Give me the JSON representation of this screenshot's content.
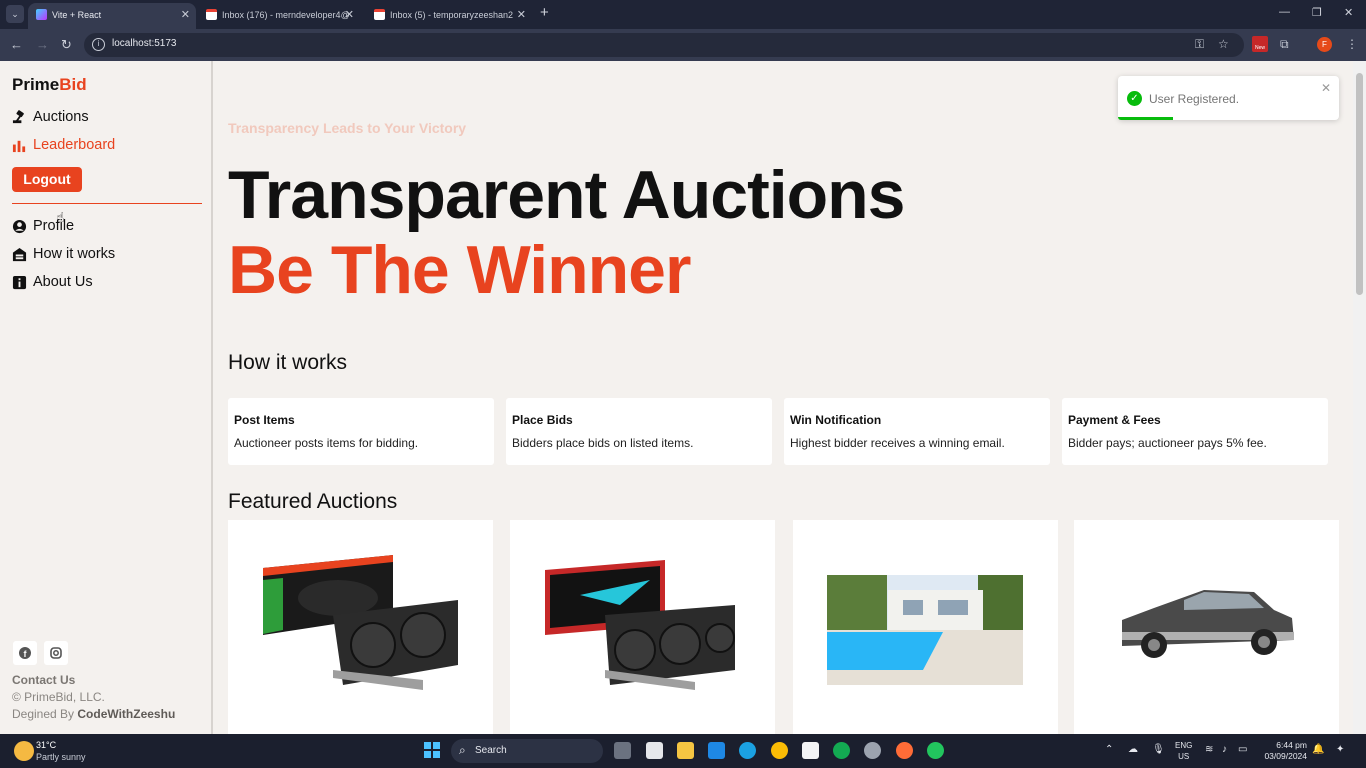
{
  "browser": {
    "tabs": [
      {
        "title": "Vite + React",
        "active": true
      },
      {
        "title": "Inbox (176) - merndeveloper4@",
        "active": false
      },
      {
        "title": "Inbox (5) - temporaryzeeshan2",
        "active": false
      }
    ],
    "url": "localhost:5173",
    "new_badge": "New",
    "profile_initial": "F"
  },
  "sidebar": {
    "brand_prefix": "Prime",
    "brand_accent": "Bid",
    "nav": [
      {
        "label": "Auctions",
        "icon": "gavel-icon"
      },
      {
        "label": "Leaderboard",
        "icon": "bar-chart-icon"
      }
    ],
    "logout_label": "Logout",
    "nav2": [
      {
        "label": "Profile",
        "icon": "user-circle-icon"
      },
      {
        "label": "How it works",
        "icon": "garage-icon"
      },
      {
        "label": "About Us",
        "icon": "info-icon"
      }
    ],
    "contact_label": "Contact Us",
    "copyright": "© PrimeBid, LLC.",
    "designed_prefix": "Degined By ",
    "designed_by": "CodeWithZeeshu"
  },
  "hero": {
    "tagline": "Transparency Leads to Your Victory",
    "title_line1": "Transparent Auctions",
    "title_line2": "Be The Winner"
  },
  "how_it_works": {
    "heading": "How it works",
    "cards": [
      {
        "title": "Post Items",
        "desc": "Auctioneer posts items for bidding."
      },
      {
        "title": "Place Bids",
        "desc": "Bidders place bids on listed items."
      },
      {
        "title": "Win Notification",
        "desc": "Highest bidder receives a winning email."
      },
      {
        "title": "Payment & Fees",
        "desc": "Bidder pays; auctioneer pays 5% fee."
      }
    ]
  },
  "featured": {
    "heading": "Featured Auctions",
    "items": [
      {
        "image": "gpu-gigabyte-geforce"
      },
      {
        "image": "gpu-gigabyte-radeon"
      },
      {
        "image": "villa-with-pool"
      },
      {
        "image": "classic-muscle-car"
      }
    ]
  },
  "toast": {
    "message": "User Registered.",
    "progress": 0.25
  },
  "taskbar": {
    "temperature": "31°C",
    "condition": "Partly sunny",
    "search_label": "Search",
    "lang_line1": "ENG",
    "lang_line2": "US",
    "time": "6:44 pm",
    "date": "03/09/2024"
  },
  "colors": {
    "accent": "#e8431f",
    "page_bg": "#f4f1ee",
    "toast_success": "#07bc0c"
  }
}
